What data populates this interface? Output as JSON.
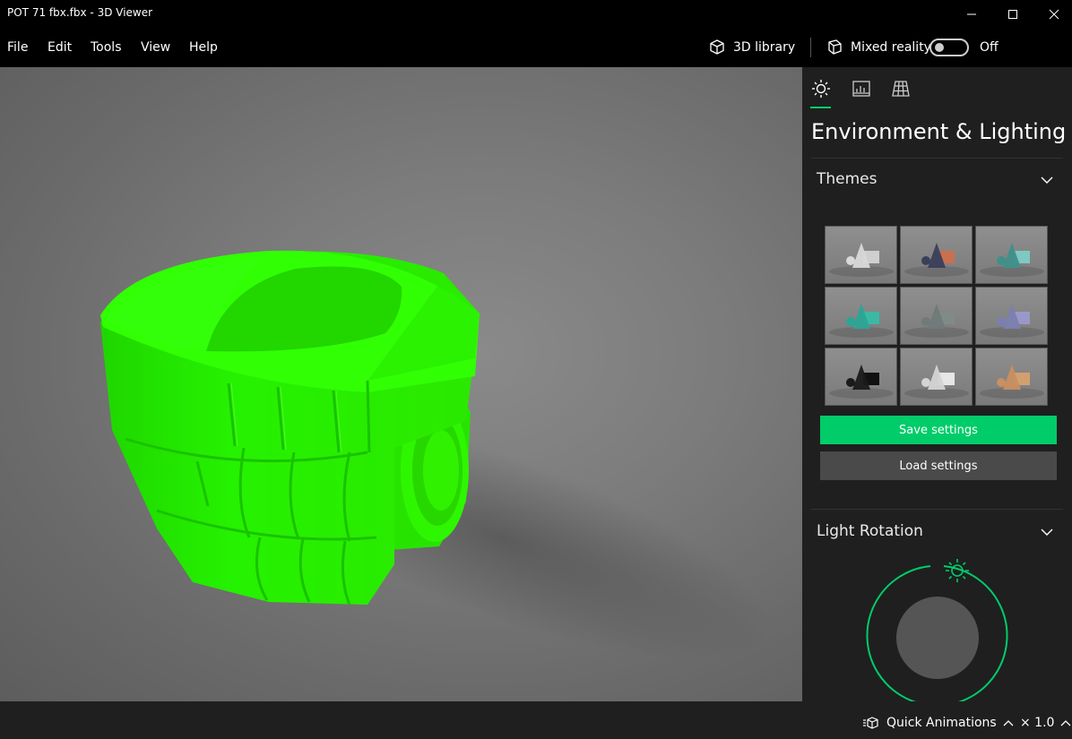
{
  "window": {
    "title": "POT 71 fbx.fbx - 3D Viewer"
  },
  "menu": {
    "items": [
      "File",
      "Edit",
      "Tools",
      "View",
      "Help"
    ]
  },
  "toolbar": {
    "library_label": "3D library",
    "mixed_reality_label": "Mixed reality",
    "toggle_state_label": "Off"
  },
  "panel": {
    "title": "Environment & Lighting",
    "themes_label": "Themes",
    "save_label": "Save settings",
    "load_label": "Load settings",
    "light_rotation_label": "Light Rotation",
    "accent": "#00cc6a",
    "themes": [
      {
        "shape_a": "#d8d8d8",
        "shape_b": "#cfcfcf"
      },
      {
        "shape_a": "#3a3f5a",
        "shape_b": "#c87050"
      },
      {
        "shape_a": "#3f8f8a",
        "shape_b": "#7fc9c2"
      },
      {
        "shape_a": "#2aa596",
        "shape_b": "#3bb9a4"
      },
      {
        "shape_a": "#707a78",
        "shape_b": "#808b88"
      },
      {
        "shape_a": "#7b7fb0",
        "shape_b": "#9a98c8"
      },
      {
        "shape_a": "#1a1a1a",
        "shape_b": "#111111"
      },
      {
        "shape_a": "#d4d4d4",
        "shape_b": "#e6e6e6"
      },
      {
        "shape_a": "#c98f60",
        "shape_b": "#d2a070"
      }
    ]
  },
  "status": {
    "quick_animations_label": "Quick Animations",
    "speed_label": "× 1.0"
  },
  "model": {
    "color": "#22f500"
  }
}
